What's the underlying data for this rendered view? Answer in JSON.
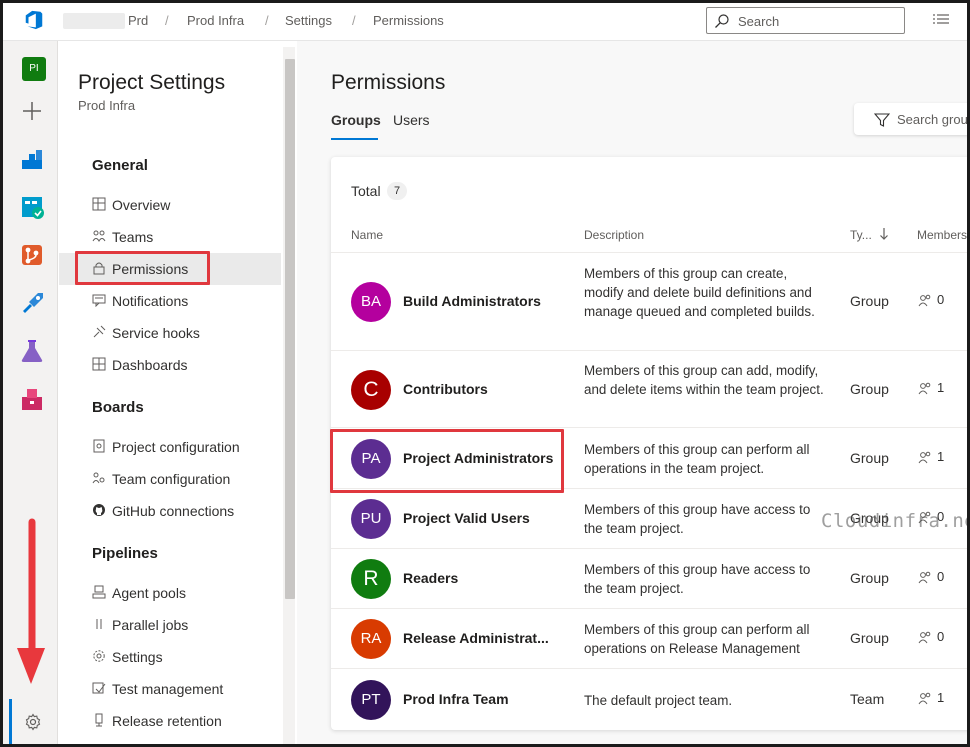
{
  "topbar": {
    "breadcrumbs": [
      "Prd",
      "Prod Infra",
      "Settings",
      "Permissions"
    ],
    "search_placeholder": "Search"
  },
  "rail": {
    "project_initials": "PI"
  },
  "nav": {
    "title": "Project Settings",
    "subtitle": "Prod Infra",
    "sections": [
      {
        "label": "General",
        "items": [
          "Overview",
          "Teams",
          "Permissions",
          "Notifications",
          "Service hooks",
          "Dashboards"
        ]
      },
      {
        "label": "Boards",
        "items": [
          "Project configuration",
          "Team configuration",
          "GitHub connections"
        ]
      },
      {
        "label": "Pipelines",
        "items": [
          "Agent pools",
          "Parallel jobs",
          "Settings",
          "Test management",
          "Release retention"
        ]
      }
    ],
    "selected_item": "Permissions"
  },
  "main": {
    "title": "Permissions",
    "tabs": [
      "Groups",
      "Users"
    ],
    "active_tab": "Groups",
    "filter_placeholder": "Search groups",
    "total_label": "Total",
    "total_count": "7",
    "columns": {
      "name": "Name",
      "description": "Description",
      "type": "Ty...",
      "members": "Members"
    },
    "groups": [
      {
        "initials": "BA",
        "color": "#b4009e",
        "name": "Build Administrators",
        "description": "Members of this group can create, modify and delete build definitions and manage queued and completed builds.",
        "type": "Group",
        "members": "0"
      },
      {
        "initials": "C",
        "color": "#a80000",
        "name": "Contributors",
        "description": "Members of this group can add, modify, and delete items within the team project.",
        "type": "Group",
        "members": "1"
      },
      {
        "initials": "PA",
        "color": "#5c2d91",
        "name": "Project Administrators",
        "description": "Members of this group can perform all operations in the team project.",
        "type": "Group",
        "members": "1"
      },
      {
        "initials": "PU",
        "color": "#5c2d91",
        "name": "Project Valid Users",
        "description": "Members of this group have access to the team project.",
        "type": "Group",
        "members": "0"
      },
      {
        "initials": "R",
        "color": "#107c10",
        "name": "Readers",
        "description": "Members of this group have access to the team project.",
        "type": "Group",
        "members": "0"
      },
      {
        "initials": "RA",
        "color": "#d83b01",
        "name": "Release Administrat...",
        "description": "Members of this group can perform all operations on Release Management",
        "type": "Group",
        "members": "0"
      },
      {
        "initials": "PT",
        "color": "#32145a",
        "name": "Prod Infra Team",
        "description": "The default project team.",
        "type": "Team",
        "members": "1"
      }
    ]
  },
  "watermark": "Cloudinfra.net",
  "colors": {
    "accent": "#0078d4",
    "highlight": "#e0383e"
  }
}
